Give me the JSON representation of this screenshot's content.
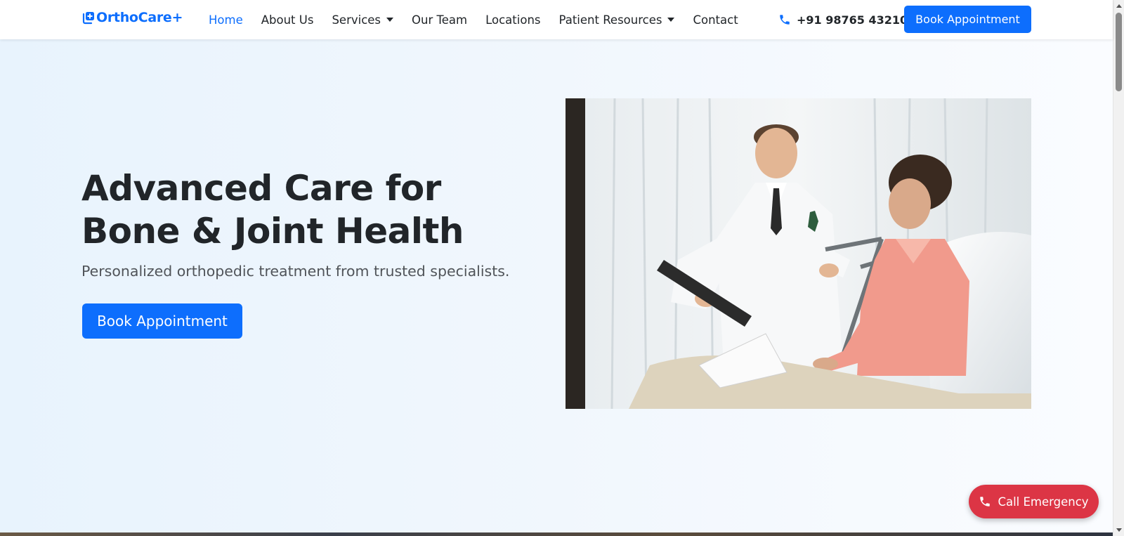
{
  "brand": {
    "name": "OrthoCare+",
    "color": "#0d6efd"
  },
  "nav": {
    "items": [
      {
        "label": "Home",
        "active": true
      },
      {
        "label": "About Us"
      },
      {
        "label": "Services",
        "dropdown": true
      },
      {
        "label": "Our Team"
      },
      {
        "label": "Locations"
      },
      {
        "label": "Patient Resources",
        "dropdown": true
      },
      {
        "label": "Contact"
      }
    ],
    "phone": "+91 98765 43210",
    "phone_icon": "phone-icon",
    "cta_label": "Book Appointment"
  },
  "hero": {
    "title": "Advanced Care for Bone & Joint Health",
    "subtitle": "Personalized orthopedic treatment from trusted specialists.",
    "cta_label": "Book Appointment"
  },
  "emergency": {
    "label": "Call Emergency",
    "icon": "phone-icon",
    "color": "#dc3545"
  },
  "colors": {
    "primary": "#0d6efd",
    "danger": "#dc3545",
    "text": "#212529",
    "hero_bg": "#eaf4fd"
  }
}
